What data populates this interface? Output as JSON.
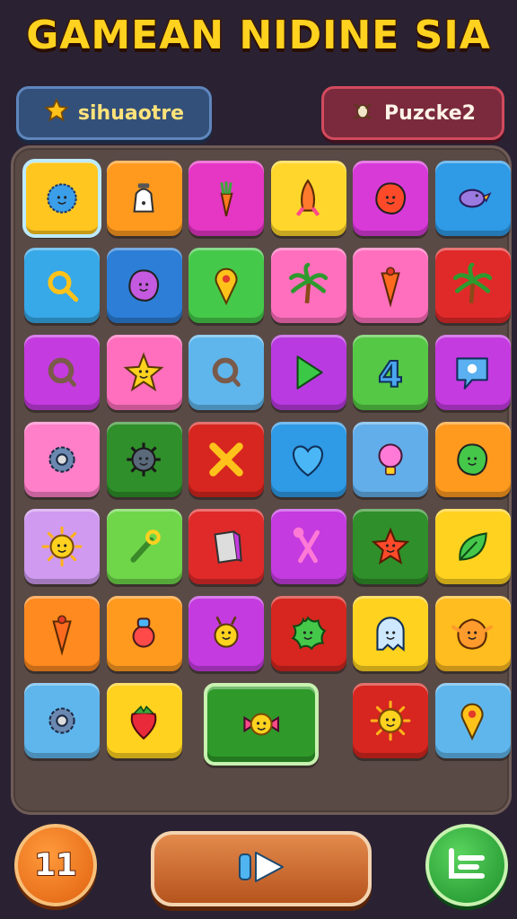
{
  "header": {
    "title": "GAMEAN NIDINE SIA"
  },
  "left_badge": {
    "label": "sihuaotre",
    "icon": "star-icon",
    "icon_color": "#ffc21a"
  },
  "right_badge": {
    "label": "Puzcke2",
    "icon": "bug-icon"
  },
  "board": {
    "rows": [
      [
        {
          "color": "#ffc61f",
          "icon": "fuzzy-blue-monster-icon",
          "selected": true
        },
        {
          "color": "#ff9a1f",
          "icon": "bell-icon"
        },
        {
          "color": "#e536c4",
          "icon": "carrot-icon"
        },
        {
          "color": "#ffd72c",
          "icon": "rocket-icon"
        },
        {
          "color": "#d83ad8",
          "icon": "red-blob-icon"
        },
        {
          "color": "#2f9ae6",
          "icon": "purple-bird-icon"
        }
      ],
      [
        {
          "color": "#37a8e8",
          "icon": "magnifier-icon"
        },
        {
          "color": "#2c7ed6",
          "icon": "purple-blob-icon"
        },
        {
          "color": "#45c94a",
          "icon": "map-pin-icon"
        },
        {
          "color": "#ff6fbd",
          "icon": "palm-tree-icon"
        },
        {
          "color": "#ff6fbd",
          "icon": "cone-icon"
        },
        {
          "color": "#e02a2a",
          "icon": "palm-tree-icon"
        }
      ],
      [
        {
          "color": "#c43be0",
          "icon": "ring-icon"
        },
        {
          "color": "#ff6fbd",
          "icon": "star-creature-icon"
        },
        {
          "color": "#5fb6ec",
          "icon": "ring-icon"
        },
        {
          "color": "#b93ae0",
          "icon": "play-arrow-icon"
        },
        {
          "color": "#55c845",
          "icon": "number-four-icon"
        },
        {
          "color": "#c43be0",
          "icon": "speech-bubble-icon"
        }
      ],
      [
        {
          "color": "#ff7fc8",
          "icon": "gear-icon"
        },
        {
          "color": "#2f8f2a",
          "icon": "spiky-ball-icon"
        },
        {
          "color": "#d6261f",
          "icon": "cross-icon"
        },
        {
          "color": "#2f9ae6",
          "icon": "heart-icon"
        },
        {
          "color": "#62aeea",
          "icon": "lightbulb-icon"
        },
        {
          "color": "#ff9a1f",
          "icon": "green-blob-icon"
        }
      ],
      [
        {
          "color": "#cf9af0",
          "icon": "sun-icon"
        },
        {
          "color": "#6fd64a",
          "icon": "wrench-icon"
        },
        {
          "color": "#e02a2a",
          "icon": "book-icon"
        },
        {
          "color": "#c43be0",
          "icon": "scissors-icon"
        },
        {
          "color": "#2f8f2a",
          "icon": "red-star-creature-icon"
        },
        {
          "color": "#ffd21f",
          "icon": "leaf-icon"
        }
      ],
      [
        {
          "color": "#ff8a1f",
          "icon": "cone-icon"
        },
        {
          "color": "#ff9a1f",
          "icon": "toy-icon"
        },
        {
          "color": "#c43be0",
          "icon": "yellow-bug-icon"
        },
        {
          "color": "#d6261f",
          "icon": "green-splat-icon"
        },
        {
          "color": "#ffd21f",
          "icon": "ghost-icon"
        },
        {
          "color": "#ffbd1f",
          "icon": "orange-creature-icon"
        }
      ]
    ],
    "last_row": [
      {
        "color": "#5fb6ec",
        "icon": "gear-icon"
      },
      {
        "color": "#ffd21f",
        "icon": "strawberry-icon"
      },
      {
        "color": "#2f9a2a",
        "icon": "sun-bow-icon",
        "wide": true
      },
      {
        "color": "#d6261f",
        "icon": "sun-icon"
      },
      {
        "color": "#5fb6ec",
        "icon": "map-pin-icon"
      }
    ]
  },
  "footer": {
    "left_label": "11",
    "play_icon": "play-icon",
    "right_icon": "list-icon"
  }
}
